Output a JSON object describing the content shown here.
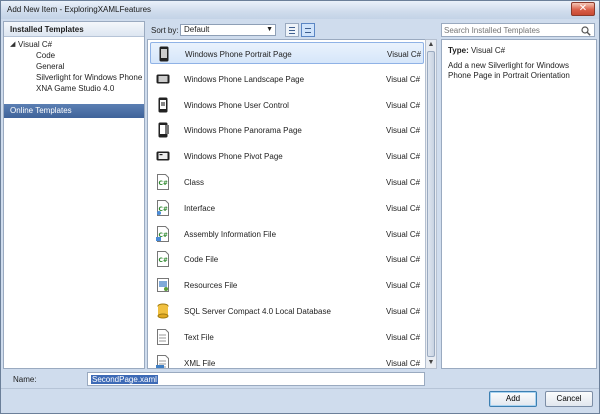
{
  "window": {
    "title": "Add New Item - ExploringXAMLFeatures",
    "close_glyph": "✕"
  },
  "left": {
    "header": "Installed Templates",
    "tree": [
      {
        "label": "Visual C#",
        "level": 0,
        "expanded": true
      },
      {
        "label": "Code",
        "level": 1
      },
      {
        "label": "General",
        "level": 1
      },
      {
        "label": "Silverlight for Windows Phone",
        "level": 1
      },
      {
        "label": "XNA Game Studio 4.0",
        "level": 1
      }
    ],
    "online": "Online Templates"
  },
  "sort": {
    "label": "Sort by:",
    "value": "Default"
  },
  "search": {
    "placeholder": "Search Installed Templates"
  },
  "items": [
    {
      "name": "Windows Phone Portrait Page",
      "lang": "Visual C#",
      "icon": "phone-portrait-icon",
      "selected": true
    },
    {
      "name": "Windows Phone Landscape Page",
      "lang": "Visual C#",
      "icon": "phone-landscape-icon"
    },
    {
      "name": "Windows Phone User Control",
      "lang": "Visual C#",
      "icon": "user-control-icon"
    },
    {
      "name": "Windows Phone Panorama Page",
      "lang": "Visual C#",
      "icon": "panorama-icon"
    },
    {
      "name": "Windows Phone Pivot Page",
      "lang": "Visual C#",
      "icon": "pivot-icon"
    },
    {
      "name": "Class",
      "lang": "Visual C#",
      "icon": "csharp-class-icon"
    },
    {
      "name": "Interface",
      "lang": "Visual C#",
      "icon": "csharp-interface-icon"
    },
    {
      "name": "Assembly Information File",
      "lang": "Visual C#",
      "icon": "csharp-file-icon"
    },
    {
      "name": "Code File",
      "lang": "Visual C#",
      "icon": "csharp-code-icon"
    },
    {
      "name": "Resources File",
      "lang": "Visual C#",
      "icon": "resources-icon"
    },
    {
      "name": "SQL Server Compact 4.0 Local Database",
      "lang": "Visual C#",
      "icon": "database-icon"
    },
    {
      "name": "Text File",
      "lang": "Visual C#",
      "icon": "text-file-icon"
    },
    {
      "name": "XML File",
      "lang": "Visual C#",
      "icon": "xml-file-icon"
    }
  ],
  "details": {
    "type_label": "Type:",
    "type_value": "Visual C#",
    "description": "Add a new Silverlight for Windows Phone Page in Portrait Orientation"
  },
  "footer": {
    "name_label": "Name:",
    "name_value": "SecondPage.xaml",
    "add_label": "Add",
    "cancel_label": "Cancel"
  },
  "colors": {
    "accent": "#3f639a",
    "selection": "#d6e6fa"
  }
}
